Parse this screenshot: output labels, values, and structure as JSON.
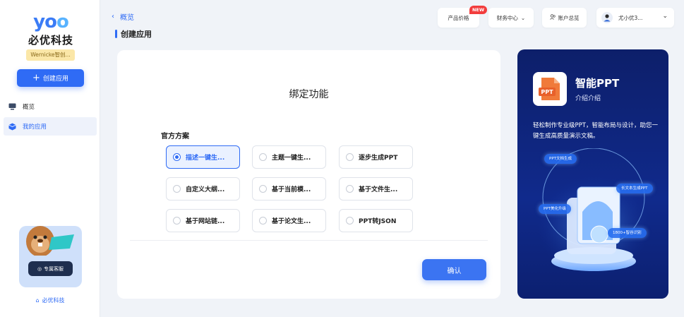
{
  "brand": {
    "logo_mark": "yoo",
    "logo_name": "必优科技",
    "org_badge": "Wernicke智创...",
    "footer": "必优科技"
  },
  "sidebar": {
    "create_label": "创建应用",
    "nav": [
      {
        "label": "概览",
        "icon": "monitor-icon",
        "active": false
      },
      {
        "label": "我的应用",
        "icon": "app-box-icon",
        "active": true
      }
    ],
    "mascot_button": "专属客服"
  },
  "header": {
    "back_label": "概览",
    "page_title": "创建应用",
    "product_price": "产品价格",
    "new_tag": "NEW",
    "finance": "财务中心",
    "account": "账户总览",
    "user_name": "尤小优3..."
  },
  "main": {
    "heading": "绑定功能",
    "section_label": "官方方案",
    "options": [
      {
        "label": "描述一键生...",
        "selected": true
      },
      {
        "label": "主题一键生...",
        "selected": false
      },
      {
        "label": "逐步生成PPT",
        "selected": false
      },
      {
        "label": "自定义大纲...",
        "selected": false
      },
      {
        "label": "基于当前模...",
        "selected": false
      },
      {
        "label": "基于文件生...",
        "selected": false
      },
      {
        "label": "基于网站链...",
        "selected": false
      },
      {
        "label": "基于论文生...",
        "selected": false
      },
      {
        "label": "PPT转JSON",
        "selected": false
      }
    ],
    "confirm_label": "确认"
  },
  "promo": {
    "icon_label": "PPT",
    "title": "智能PPT",
    "subtitle": "介绍介绍",
    "description": "轻松制作专业级PPT，智能布局与设计，助您一键生成高质量演示文稿。",
    "chips": [
      "PPT文档生成",
      "长文本生成PPT",
      "PPT美化升级",
      "1800+智谷识别"
    ]
  },
  "colors": {
    "accent": "#2f6bf5",
    "promo_bg": "#0d1f6a",
    "new_tag": "#f23d3d"
  }
}
